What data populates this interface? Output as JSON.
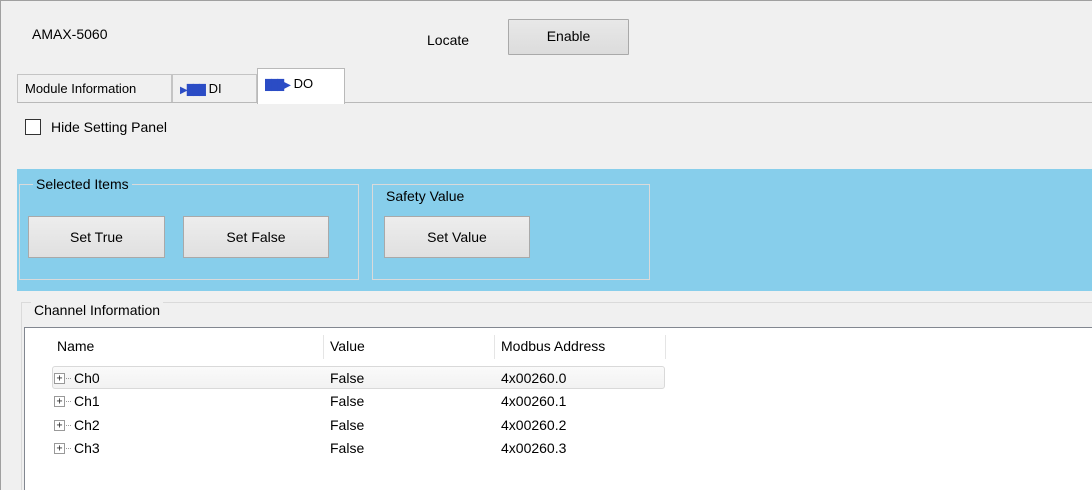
{
  "header": {
    "module_name": "AMAX-5060",
    "locate_label": "Locate",
    "enable_label": "Enable"
  },
  "tabs": [
    {
      "label": "Module Information",
      "icon": ""
    },
    {
      "label": "DI",
      "icon": "di-signal-icon"
    },
    {
      "label": "DO",
      "icon": "do-signal-icon"
    }
  ],
  "active_tab": "DO",
  "setting": {
    "hide_label": "Hide Setting Panel",
    "hide_checked": false,
    "panel_color": "#87ceeb",
    "selected_items": {
      "legend": "Selected Items",
      "set_true": "Set True",
      "set_false": "Set False"
    },
    "safety_value": {
      "legend": "Safety Value",
      "set_value": "Set Value"
    }
  },
  "channel_info": {
    "legend": "Channel Information",
    "columns": [
      "Name",
      "Value",
      "Modbus Address"
    ],
    "rows": [
      {
        "name": "Ch0",
        "value": "False",
        "address": "4x00260.0"
      },
      {
        "name": "Ch1",
        "value": "False",
        "address": "4x00260.1"
      },
      {
        "name": "Ch2",
        "value": "False",
        "address": "4x00260.2"
      },
      {
        "name": "Ch3",
        "value": "False",
        "address": "4x00260.3"
      }
    ]
  }
}
